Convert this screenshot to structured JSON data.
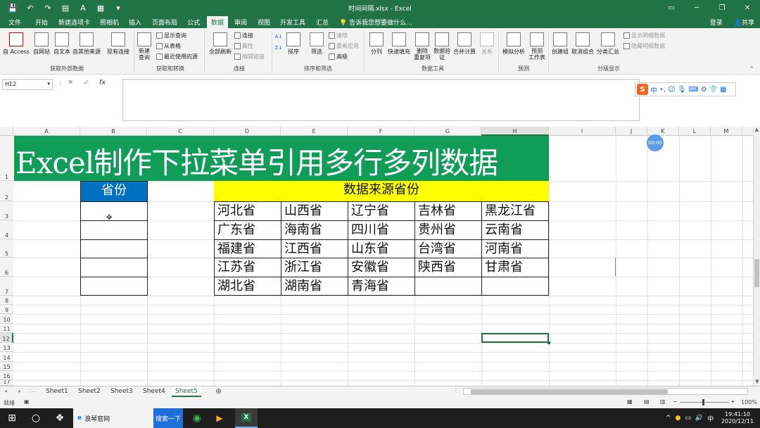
{
  "window": {
    "title": "时间间隔.xlsx - Excel",
    "buttons": [
      "▭",
      "─",
      "❐",
      "✕"
    ]
  },
  "quick_access": [
    "save-icon",
    "undo-icon",
    "redo-icon",
    "custom-icon",
    "format-icon",
    "table-icon",
    "more-icon"
  ],
  "tabs": [
    "文件",
    "开始",
    "新建选项卡",
    "照相机",
    "插入",
    "页面布局",
    "公式",
    "数据",
    "审阅",
    "视图",
    "开发工具",
    "汇总"
  ],
  "active_tab": "数据",
  "tell_me": "告诉我您想要做什么...",
  "account": {
    "login": "登录",
    "share": "共享"
  },
  "ribbon": {
    "get_external": {
      "label": "获取外部数据",
      "buttons": [
        "自 Access",
        "自网站",
        "自文本",
        "自其他来源",
        "现有连接"
      ]
    },
    "transform": {
      "label": "获取和转换",
      "new_query": "新建\n查询",
      "small": [
        "显示查询",
        "从表格",
        "最近使用的源"
      ]
    },
    "connections": {
      "label": "连接",
      "refresh": "全部刷新",
      "small": [
        "连接",
        "属性",
        "编辑链接"
      ]
    },
    "sort_filter": {
      "label": "排序和筛选",
      "sort": "排序",
      "filter": "筛选",
      "small": [
        "清除",
        "重新应用",
        "高级"
      ]
    },
    "data_tools": {
      "label": "数据工具",
      "buttons": [
        "分列",
        "快速填充",
        "删除\n重复项",
        "数据验\n证",
        "合并计算",
        "关系"
      ]
    },
    "forecast": {
      "label": "预测",
      "buttons": [
        "模拟分析",
        "预测\n工作表"
      ]
    },
    "outline": {
      "label": "分级显示",
      "buttons": [
        "创建组",
        "取消组合",
        "分类汇总"
      ],
      "small": [
        "显示明细数据",
        "隐藏明细数据"
      ]
    }
  },
  "formula_bar": {
    "name_box": "H12",
    "content": ""
  },
  "columns": [
    "A",
    "B",
    "C",
    "D",
    "E",
    "F",
    "G",
    "H",
    "I",
    "J",
    "K",
    "L",
    "M"
  ],
  "rows": [
    "1",
    "2",
    "3",
    "4",
    "5",
    "6",
    "7",
    "8",
    "9",
    "10",
    "11",
    "12",
    "13",
    "14",
    "15",
    "16",
    "17"
  ],
  "sheet": {
    "banner": "Excel制作下拉菜单引用多行多列数据",
    "b2": "省份",
    "d2": "数据来源省份",
    "provinces": [
      [
        "河北省",
        "山西省",
        "辽宁省",
        "吉林省",
        "黑龙江省"
      ],
      [
        "广东省",
        "海南省",
        "四川省",
        "贵州省",
        "云南省"
      ],
      [
        "福建省",
        "江西省",
        "山东省",
        "台湾省",
        "河南省"
      ],
      [
        "江苏省",
        "浙江省",
        "安徽省",
        "陕西省",
        "甘肃省"
      ],
      [
        "湖北省",
        "湖南省",
        "青海省",
        "",
        ""
      ]
    ]
  },
  "timer": "00:00",
  "sheets": [
    "Sheet1",
    "Sheet2",
    "Sheet3",
    "Sheet4",
    "Sheet5"
  ],
  "active_sheet": "Sheet5",
  "status": {
    "ready": "就绪",
    "zoom": "100%"
  },
  "taskbar": {
    "browser": "浪琴官网",
    "search": "搜索一下",
    "time": "19:41:10",
    "date": "2020/12/11",
    "ime": "中"
  },
  "colors": {
    "excel_green": "#217346",
    "banner": "#0f9d58",
    "blue_header": "#0070c0",
    "yellow_header": "#ffff00"
  }
}
